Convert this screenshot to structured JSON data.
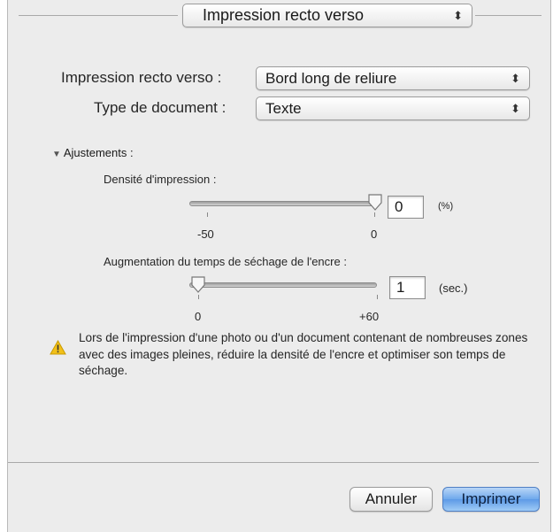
{
  "header": {
    "preset_popup": "Impression recto verso"
  },
  "form": {
    "duplex_label": "Impression recto verso :",
    "duplex_value": "Bord long de reliure",
    "doctype_label": "Type de document :",
    "doctype_value": "Texte"
  },
  "adjustments": {
    "disclosure_label": "Ajustements :",
    "density": {
      "label": "Densité d'impression :",
      "min_label": "-50",
      "max_label": "0",
      "value": "0",
      "unit": "(%)",
      "level": 1.0
    },
    "drying": {
      "label": "Augmentation du temps de séchage de l'encre :",
      "min_label": "0",
      "max_label": "+60",
      "value": "1",
      "unit": "(sec.)",
      "level": 0.0
    }
  },
  "warning": {
    "text": "Lors de l'impression d'une photo ou d'un document contenant de nombreuses zones avec des images pleines, réduire la densité de l'encre et optimiser son temps de séchage."
  },
  "buttons": {
    "cancel": "Annuler",
    "print": "Imprimer"
  },
  "colors": {
    "dialog_bg": "#ececec",
    "primary_button": "#6ea8ec",
    "warning_icon": "#f2c018"
  }
}
